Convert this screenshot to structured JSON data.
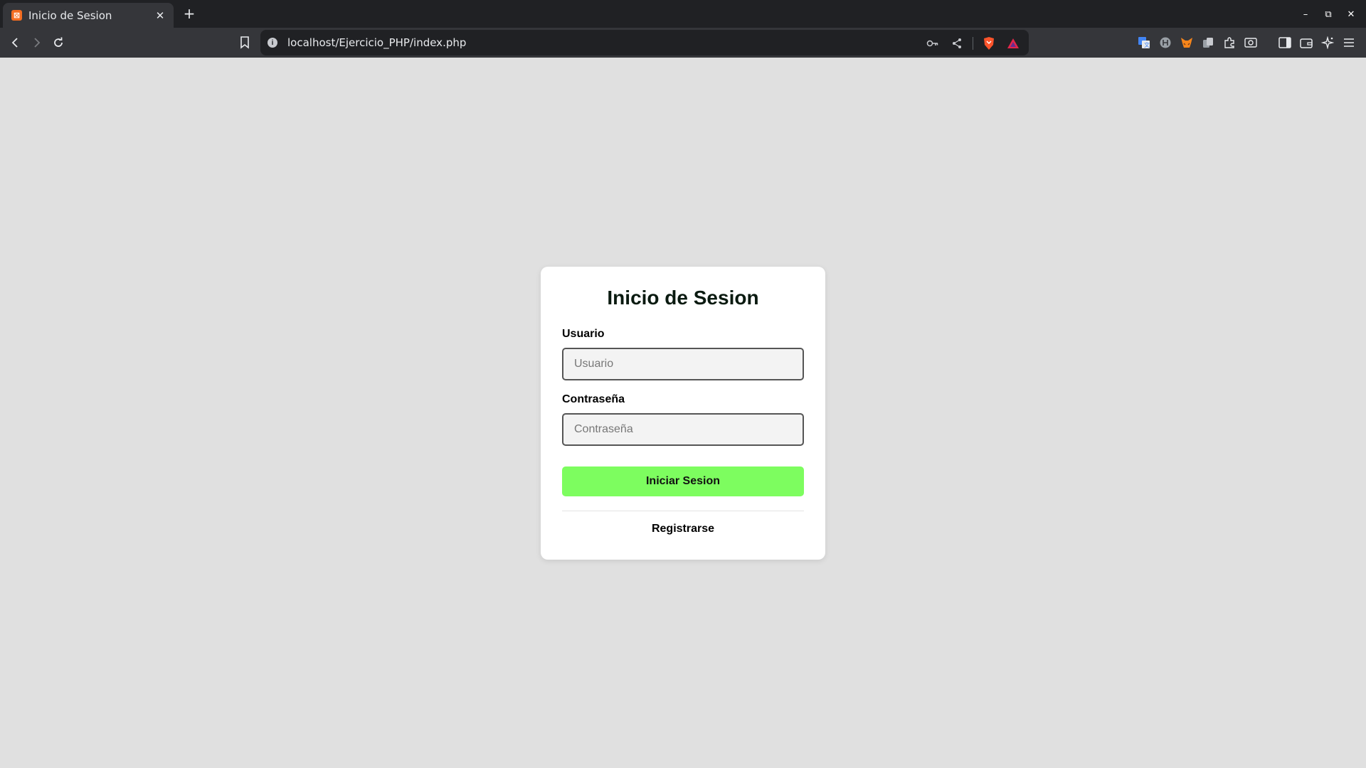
{
  "browser": {
    "tab": {
      "title": "Inicio de Sesion",
      "favicon_text": "⊠"
    },
    "new_tab_label": "+",
    "url": "localhost/Ejercicio_PHP/index.php",
    "info_glyph": "i",
    "window_controls": {
      "minimize": "–",
      "maximize": "⧉",
      "close": "✕"
    }
  },
  "login": {
    "title": "Inicio de Sesion",
    "user_label": "Usuario",
    "user_placeholder": "Usuario",
    "user_value": "",
    "password_label": "Contraseña",
    "password_placeholder": "Contraseña",
    "password_value": "",
    "submit_label": "Iniciar Sesion",
    "register_label": "Registrarse"
  },
  "colors": {
    "page_background": "#e0e0e0",
    "submit_button": "#7dfd5f",
    "title_text": "#0a1a10"
  },
  "icons": [
    "back-icon",
    "forward-icon",
    "reload-icon",
    "bookmark-icon",
    "info-icon",
    "key-icon",
    "share-icon",
    "brave-shields-icon",
    "brave-rewards-icon",
    "translate-icon",
    "extension-icon",
    "metamask-icon",
    "extension-icon",
    "puzzle-icon",
    "screenshot-icon",
    "sidebar-icon",
    "wallet-icon",
    "leo-icon",
    "menu-icon"
  ]
}
